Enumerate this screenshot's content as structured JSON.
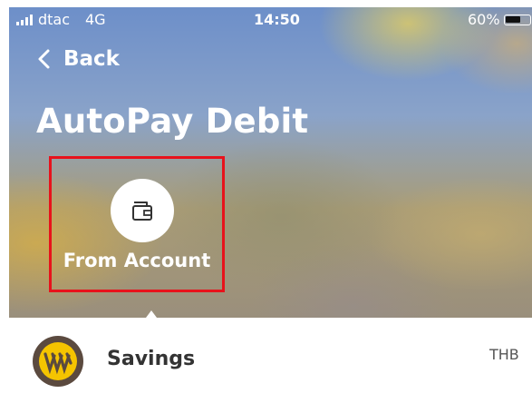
{
  "status_bar": {
    "carrier": "dtac",
    "network": "4G",
    "time": "14:50",
    "battery_percent": "60%"
  },
  "nav": {
    "back_label": "Back",
    "back_icon": "chevron-left-icon"
  },
  "page": {
    "title": "AutoPay Debit"
  },
  "source_selector": {
    "label": "From Account",
    "icon": "wallet-icon",
    "highlight_color": "#e8121b"
  },
  "account": {
    "name": "Savings",
    "currency": "THB",
    "logo_icon": "krungsri-bank-logo",
    "logo_colors": {
      "ring": "#5b4a3f",
      "mark": "#f5c400"
    }
  }
}
